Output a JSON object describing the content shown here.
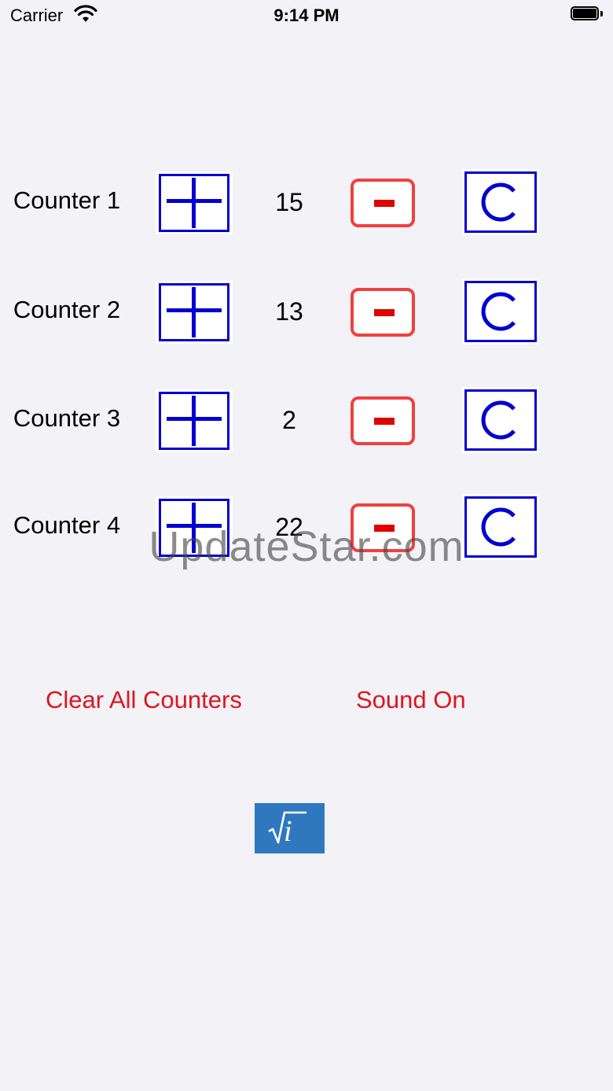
{
  "status_bar": {
    "carrier": "Carrier",
    "time": "9:14 PM",
    "icons": [
      "wifi-icon",
      "battery-icon"
    ]
  },
  "counters": [
    {
      "label": "Counter 1",
      "value": "15"
    },
    {
      "label": "Counter 2",
      "value": "13"
    },
    {
      "label": "Counter 3",
      "value": "2"
    },
    {
      "label": "Counter 4",
      "value": "22"
    }
  ],
  "buttons": {
    "clear_all_label": "Clear All Counters",
    "sound_label": "Sound On",
    "info_icon": "sqrt-i-icon",
    "info_glyph": "i"
  },
  "watermark": "UpdateStar.com",
  "colors": {
    "accent_blue": "#0000d0",
    "accent_red": "#e0141e",
    "info_bg": "#2f78c0",
    "background": "#f2f2f7"
  }
}
